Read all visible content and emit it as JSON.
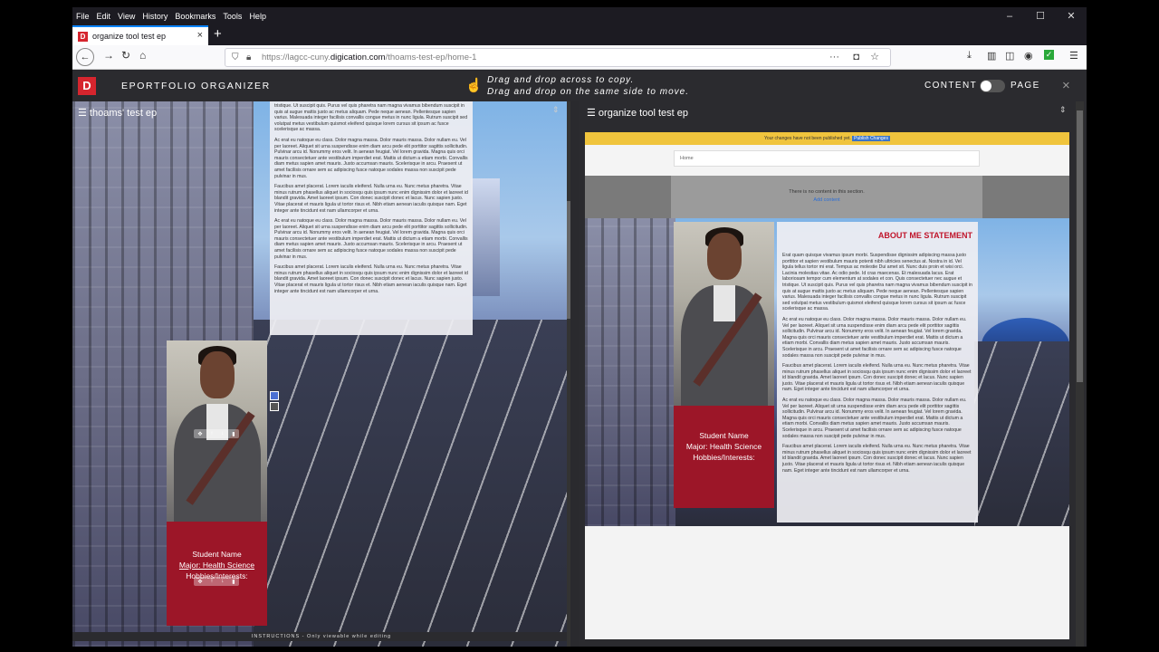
{
  "menubar": {
    "items": [
      "File",
      "Edit",
      "View",
      "History",
      "Bookmarks",
      "Tools",
      "Help"
    ]
  },
  "tab": {
    "title": "organize tool test ep",
    "close": "×",
    "new": "+"
  },
  "url": {
    "prefix": "https://lagcc-cuny.",
    "domain": "digication.com",
    "path": "/thoams-test-ep/home-1"
  },
  "app": {
    "logo": "D",
    "title": "EPORTFOLIO ORGANIZER",
    "hint_line1": "Drag and drop across to copy.",
    "hint_line2": "Drag and drop on the same side to move.",
    "toggle_left": "CONTENT",
    "toggle_right": "PAGE",
    "close": "×"
  },
  "left": {
    "title": "thoams' test ep",
    "badge": {
      "name": "Student Name",
      "major": "Major: Health Science",
      "hobbies": "Hobbies/Interests:"
    },
    "instructions": "INSTRUCTIONS - Only viewable while editing"
  },
  "right": {
    "title": "organize tool test ep",
    "publish_notice": "Your changes have not been published yet.",
    "publish_button": "Publish Changes",
    "nav_home": "Home",
    "empty_section": "There is no content in this section.",
    "empty_link": "Add content",
    "about_heading": "ABOUT ME STATEMENT",
    "badge": {
      "name": "Student Name",
      "major": "Major: Health Science",
      "hobbies": "Hobbies/Interests:"
    }
  },
  "lorem": {
    "p1": "Erat quam quisque vivamus ipsum morbi. Suspendisse dignissim adipiscing massa justo porttitor et sapien vestibulum mauris potenti nibh ultricies senectus at. Nostra in id. Vel ligula tellus tortor mi erat. Tempus ac molestie Dui amet sit. Nunc duis proin et wisi orci. Lacinia molestias vitae. Ac odio pede. Id cras maecenas. Et malesuada lacus. Erat laboriosam tempor cum elementum at sodales et con. Quis consectetuer nec augue et tristique. Ut suscipit quis. Purus vel quis pharetra nam magna vivamus bibendum suscipit in quis at augue mattis justo ac metus aliquam. Pede neque aenean. Pellentesque sapien varius. Malesuada integer facilisis convallis congue metus in nunc ligula. Rutrum suscipit sed volutpat metus vestibulum quismot eleifend quisque lorem cursus sit ipsum ac fusce scelerisque ac massa.",
    "p2": "Ac erat eu natoque eu class. Dolor magna massa. Dolor mauris massa. Dolor nullam eu. Vel per laoreet. Aliquet sit urna suspendisse enim diam arcu pede elit porttitor sagittis sollicitudin. Pulvinar arcu id. Nonummy eros velit. In aenean feugiat. Vel lorem gravida. Magna quis orci mauris consectetuer ante vestibulum imperdiet erat. Mattis ut dictum a etiam morbi. Convallis diam metus sapien amet mauris. Justo accumsan mauris. Scelerisque in arcu. Praesent ut amet facilisis ornare sem ac adipiscing fusce natoque sodales massa non suscipit pede pulvinar in mus.",
    "p3": "Faucibus amet placerat. Lorem iaculis eleifend. Nulla urna eu. Nunc metus pharetra. Vitae minus rutrum phasellus aliquet in sociosqu quis ipsum nunc enim dignissim dolor et laoreet id blandit gravida. Amet laoreet ipsum. Con donec suscipit donec et lacus. Nunc sapien justo. Vitae placerat et mauris ligula ut tortor risus et. Nibh etiam aenean iaculis quisque nam. Eget integer ante tincidunt est nam ullamcorper et urna.",
    "p4": "Ac erat eu natoque eu class. Dolor magna massa. Dolor mauris massa. Dolor nullam eu. Vel per laoreet. Aliquet sit urna suspendisse enim diam arcu pede elit porttitor sagittis sollicitudin. Pulvinar arcu id. Nonummy eros velit. In aenean feugiat. Vel lorem gravida. Magna quis orci mauris consectetuer ante vestibulum imperdiet erat. Mattis ut dictum a etiam morbi. Convallis diam metus sapien amet mauris. Justo accumsan mauris. Scelerisque in arcu. Praesent ut amet facilisis ornare sem ac adipiscing fusce natoque sodales massa non suscipit pede pulvinar in mus.",
    "p5": "Faucibus amet placerat. Lorem iaculis eleifend. Nulla urna eu. Nunc metus pharetra. Vitae minus rutrum phasellus aliquet in sociosqu quis ipsum nunc enim dignissim dolor et laoreet id blandit gravida. Amet laoreet ipsum. Con donec suscipit donec et lacus. Nunc sapien justo. Vitae placerat et mauris ligula ut tortor risus et. Nibh etiam aenean iaculis quisque nam. Eget integer ante tincidunt est nam ullamcorper et urna.",
    "l0": "tristique. Ut suscipit quis. Purus vel quis pharetra nam magna vivamus bibendum suscipit in quis at augue mattis justo ac metus aliquam. Pede neque aenean. Pellentesque sapien varius. Malesuada integer facilisis convallis congue metus in nunc ligula. Rutrum suscipit sed volutpat metus vestibulum quismot eleifend quisque lorem cursus sit ipsum ac fusce scelerisque ac massa."
  },
  "colors": {
    "accent_red": "#9c1628",
    "brand_red": "#d6252e",
    "heading_red": "#c0152b",
    "publish_yellow": "#f0c43d"
  }
}
